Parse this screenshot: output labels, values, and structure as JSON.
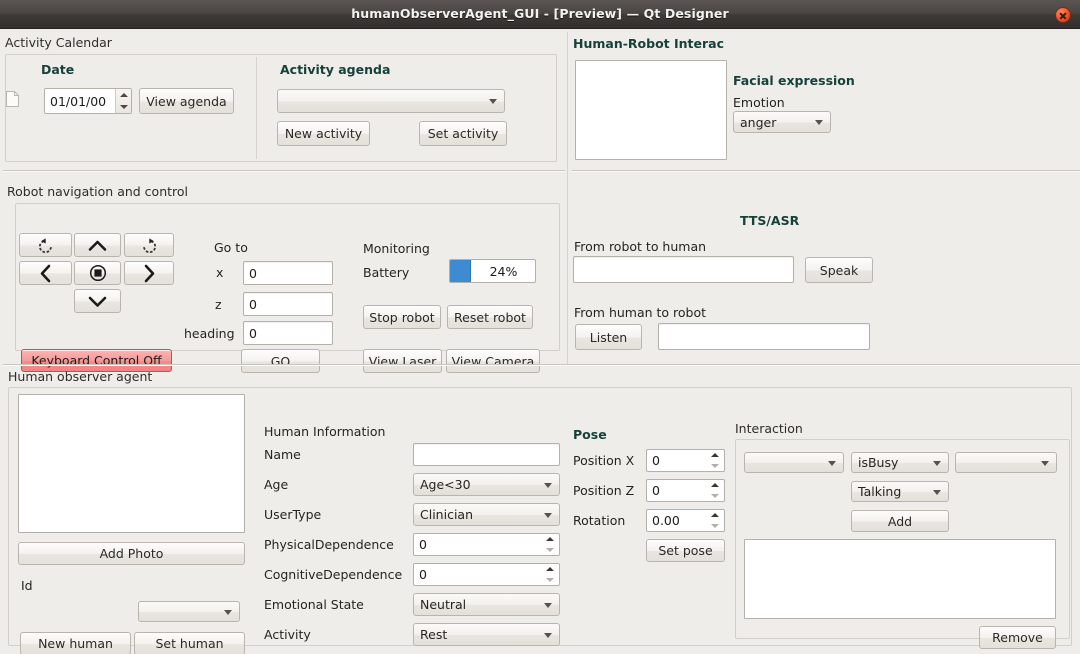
{
  "window": {
    "title": "humanObserverAgent_GUI - [Preview] — Qt Designer",
    "close_icon": "close-icon"
  },
  "activity_calendar": {
    "group_label": "Activity Calendar",
    "date": {
      "header": "Date",
      "file_icon": "document-icon",
      "value": "01/01/00",
      "view_agenda_button": "View agenda"
    },
    "agenda": {
      "header": "Activity agenda",
      "combo_value": "",
      "new_activity_button": "New activity",
      "set_activity_button": "Set activity"
    }
  },
  "human_robot_interaction": {
    "header": "Human-Robot Interac",
    "face_preview": "",
    "facial_expression_header": "Facial expression",
    "emotion_label": "Emotion",
    "emotion_value": "anger"
  },
  "robot_navigation": {
    "group_label": "Robot navigation and control",
    "dpad": {
      "rotate_ccw": "rotate-counterclockwise-icon",
      "up": "arrow-up-icon",
      "rotate_cw": "rotate-clockwise-icon",
      "left": "arrow-left-icon",
      "stop": "stop-target-icon",
      "right": "arrow-right-icon",
      "down": "arrow-down-icon"
    },
    "keyboard_control_button": "Keyboard Control Off",
    "goto": {
      "header": "Go to",
      "x_label": "x",
      "x_value": "0",
      "z_label": "z",
      "z_value": "0",
      "heading_label": "heading",
      "heading_value": "0",
      "go_button": "GO"
    },
    "monitoring": {
      "header": "Monitoring",
      "battery_label": "Battery",
      "battery_percent": 24,
      "battery_text": "24%",
      "battery_color": "#3d8bd0",
      "stop_robot_button": "Stop robot",
      "reset_robot_button": "Reset robot",
      "view_laser_button": "View Laser",
      "view_camera_button": "View Camera"
    }
  },
  "tts_asr": {
    "header": "TTS/ASR",
    "robot_to_human_label": "From robot to human",
    "robot_to_human_value": "",
    "speak_button": "Speak",
    "human_to_robot_label": "From human to robot",
    "listen_button": "Listen",
    "human_to_robot_value": ""
  },
  "human_observer_agent": {
    "group_label": "Human observer agent",
    "photo": {
      "preview": "",
      "add_photo_button": "Add Photo",
      "id_label": "Id",
      "id_value": "",
      "new_human_button": "New human",
      "set_human_button": "Set human"
    },
    "human_information": {
      "header": "Human Information",
      "fields": [
        {
          "label": "Name",
          "value": "",
          "type": "text"
        },
        {
          "label": "Age",
          "value": "Age<30",
          "type": "combo"
        },
        {
          "label": "UserType",
          "value": "Clinician",
          "type": "combo"
        },
        {
          "label": "PhysicalDependence",
          "value": "0",
          "type": "spin"
        },
        {
          "label": "CognitiveDependence",
          "value": "0",
          "type": "spin"
        },
        {
          "label": "Emotional State",
          "value": "Neutral",
          "type": "combo"
        },
        {
          "label": "Activity",
          "value": "Rest",
          "type": "combo"
        }
      ]
    },
    "pose": {
      "header": "Pose",
      "fields": [
        {
          "label": "Position X",
          "value": "0"
        },
        {
          "label": "Position Z",
          "value": "0"
        },
        {
          "label": "Rotation",
          "value": "0.00"
        }
      ],
      "set_pose_button": "Set pose"
    },
    "interaction": {
      "group_label": "Interaction",
      "subject_combo": "",
      "predicate_combo": "isBusy",
      "object_combo": "",
      "action_combo": "Talking",
      "add_button": "Add",
      "list_value": "",
      "remove_button": "Remove"
    }
  }
}
